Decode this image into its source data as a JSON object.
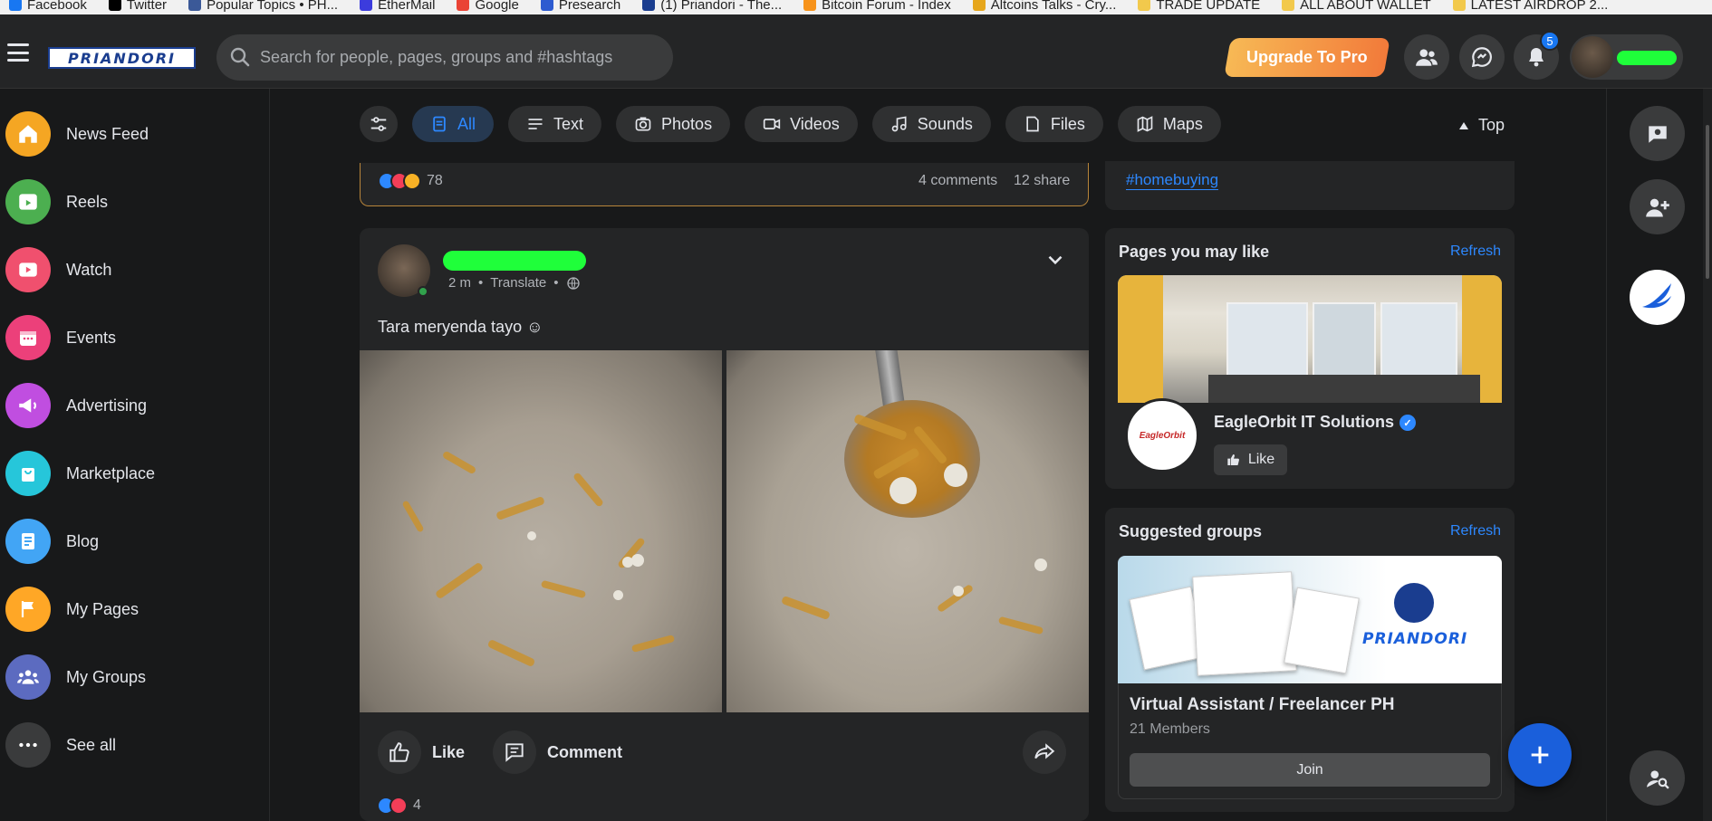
{
  "bookmarks": [
    "Facebook",
    "Twitter",
    "Popular Topics • PH...",
    "EtherMail",
    "Google",
    "Presearch",
    "(1) Priandori - The...",
    "Bitcoin Forum - Index",
    "Altcoins Talks - Cry...",
    "TRADE UPDATE",
    "ALL ABOUT WALLET",
    "LATEST AIRDROP 2..."
  ],
  "header": {
    "logo_text": "PRIANDORI",
    "search_placeholder": "Search for people, pages, groups and #hashtags",
    "upgrade_label": "Upgrade To Pro",
    "notification_count": "5"
  },
  "sidebar": {
    "items": [
      {
        "label": "News Feed",
        "color": "#f5a623"
      },
      {
        "label": "Reels",
        "color": "#4caf50"
      },
      {
        "label": "Watch",
        "color": "#f0506e"
      },
      {
        "label": "Events",
        "color": "#ec407a"
      },
      {
        "label": "Advertising",
        "color": "#c04ee0"
      },
      {
        "label": "Marketplace",
        "color": "#26c6da"
      },
      {
        "label": "Blog",
        "color": "#42a5f5"
      },
      {
        "label": "My Pages",
        "color": "#ffa726"
      },
      {
        "label": "My Groups",
        "color": "#5c6bc0"
      },
      {
        "label": "See all",
        "color": "#3a3b3c"
      }
    ]
  },
  "filters": {
    "all": "All",
    "text": "Text",
    "photos": "Photos",
    "videos": "Videos",
    "sounds": "Sounds",
    "files": "Files",
    "maps": "Maps",
    "sort": "Top"
  },
  "previous_post": {
    "reaction_count": "78",
    "comments": "4 comments",
    "shares": "12 share"
  },
  "post": {
    "time": "2 m",
    "translate": "Translate",
    "caption": "Tara meryenda tayo ☺",
    "like_label": "Like",
    "comment_label": "Comment",
    "reaction_count": "4"
  },
  "right": {
    "hashtag": "#homebuying",
    "pages_title": "Pages you may like",
    "refresh": "Refresh",
    "page_name": "EagleOrbit IT Solutions",
    "page_logo_text": "EagleOrbit",
    "page_like": "Like",
    "groups_title": "Suggested groups",
    "group_name": "Virtual Assistant / Freelancer PH",
    "group_members": "21 Members",
    "group_join": "Join",
    "group_banner_text": "PRIANDORI"
  },
  "colors": {
    "accent": "#2d88ff",
    "background": "#18191a",
    "card": "#242526"
  }
}
